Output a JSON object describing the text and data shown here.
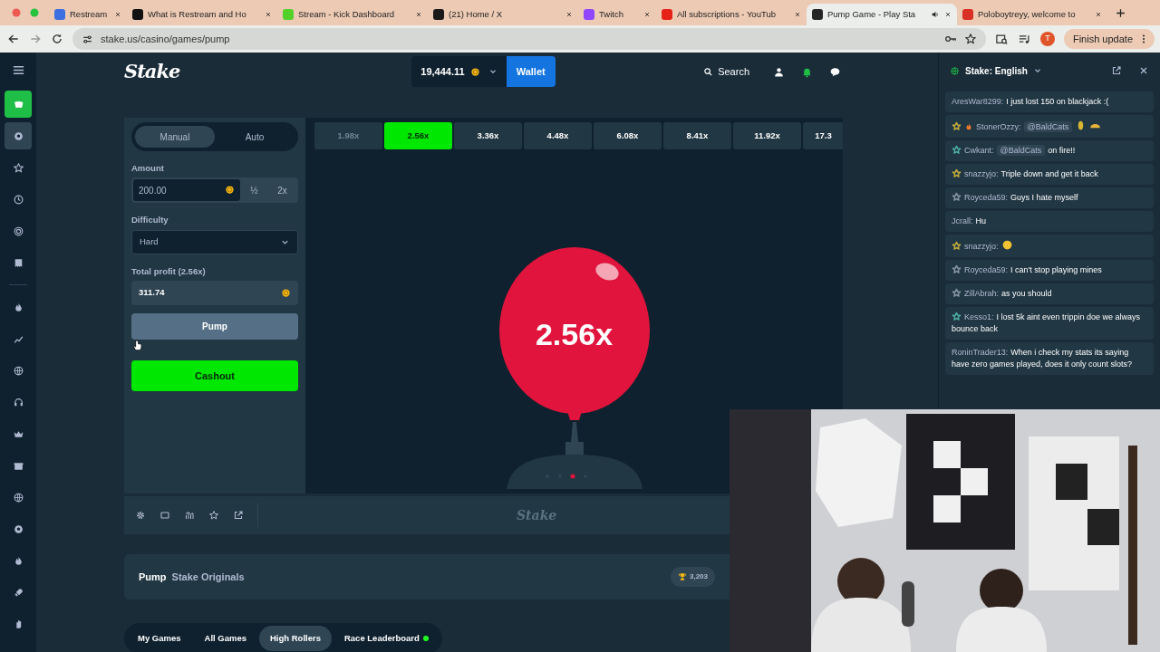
{
  "browser": {
    "tabs": [
      {
        "title": "Restream",
        "color": "#3d6fe0",
        "selected": false,
        "audio": false
      },
      {
        "title": "What is Restream and Ho",
        "color": "#111111",
        "selected": false,
        "audio": false
      },
      {
        "title": "Stream - Kick Dashboard",
        "color": "#53d12a",
        "selected": false,
        "audio": false
      },
      {
        "title": "(21) Home / X",
        "color": "#1a1a1a",
        "selected": false,
        "audio": false
      },
      {
        "title": "Twitch",
        "color": "#9147ff",
        "selected": false,
        "audio": false
      },
      {
        "title": "All subscriptions - YouTub",
        "color": "#e62117",
        "selected": false,
        "audio": false
      },
      {
        "title": "Pump Game - Play Sta",
        "color": "#262626",
        "selected": true,
        "audio": true
      },
      {
        "title": "Poloboytreyy, welcome to",
        "color": "#d93025",
        "selected": false,
        "audio": false
      }
    ],
    "url": "stake.us/casino/games/pump",
    "avatar": "T",
    "update_button": "Finish update"
  },
  "sidebar": {
    "items": [
      {
        "kind": "cards",
        "selected": true,
        "highlighted": false
      },
      {
        "kind": "ball",
        "selected": false,
        "highlighted": true
      },
      {
        "kind": "star",
        "selected": false,
        "highlighted": false
      },
      {
        "kind": "clock",
        "selected": false,
        "highlighted": false
      },
      {
        "kind": "target",
        "selected": false,
        "highlighted": false
      },
      {
        "kind": "receipt",
        "selected": false,
        "highlighted": false
      },
      {
        "kind": "divider"
      },
      {
        "kind": "fire",
        "selected": false,
        "highlighted": false
      },
      {
        "kind": "chart",
        "selected": false,
        "highlighted": false
      },
      {
        "kind": "globe",
        "selected": false,
        "highlighted": false
      },
      {
        "kind": "headset",
        "selected": false,
        "highlighted": false
      },
      {
        "kind": "crown",
        "selected": false,
        "highlighted": false
      },
      {
        "kind": "gift",
        "selected": false,
        "highlighted": false
      },
      {
        "kind": "globe",
        "selected": false,
        "highlighted": false
      },
      {
        "kind": "ball",
        "selected": false,
        "highlighted": false
      },
      {
        "kind": "fire",
        "selected": false,
        "highlighted": false
      },
      {
        "kind": "rocket",
        "selected": false,
        "highlighted": false
      },
      {
        "kind": "hand",
        "selected": false,
        "highlighted": false
      }
    ]
  },
  "header": {
    "logo": "Stake",
    "balance": "19,444.11",
    "wallet": "Wallet",
    "search": "Search"
  },
  "bet_panel": {
    "modes": [
      {
        "label": "Manual",
        "selected": true
      },
      {
        "label": "Auto",
        "selected": false
      }
    ],
    "amount_label": "Amount",
    "amount": "200.00",
    "half": "½",
    "double": "2x",
    "difficulty_label": "Difficulty",
    "difficulty": "Hard",
    "profit_label": "Total profit (2.56x)",
    "profit": "311.74",
    "pump": "Pump",
    "cashout": "Cashout"
  },
  "multipliers": [
    {
      "label": "1.98x",
      "passed": true,
      "selected": false
    },
    {
      "label": "2.56x",
      "passed": false,
      "selected": true
    },
    {
      "label": "3.36x",
      "passed": false,
      "selected": false
    },
    {
      "label": "4.48x",
      "passed": false,
      "selected": false
    },
    {
      "label": "6.08x",
      "passed": false,
      "selected": false
    },
    {
      "label": "8.41x",
      "passed": false,
      "selected": false
    },
    {
      "label": "11.92x",
      "passed": false,
      "selected": false
    },
    {
      "label": "17.3",
      "passed": false,
      "selected": false
    }
  ],
  "balloon": {
    "label": "2.56x"
  },
  "footer_logo": "Stake",
  "game_info": {
    "title": "Pump",
    "provider": "Stake Originals",
    "count": "3,203"
  },
  "lobby_tabs": [
    {
      "label": "My Games",
      "selected": false,
      "live": false
    },
    {
      "label": "All Games",
      "selected": false,
      "live": false
    },
    {
      "label": "High Rollers",
      "selected": true,
      "live": false
    },
    {
      "label": "Race Leaderboard",
      "selected": false,
      "live": true
    }
  ],
  "chat": {
    "room": "Stake: English",
    "messages": [
      {
        "user": "AresWar8299:",
        "fire": false,
        "parts": [
          {
            "kind": "text",
            "text": "I just lost 150 on blackjack :("
          }
        ]
      },
      {
        "user": "StonerOzzy:",
        "badge": {
          "color": "#c9b13c"
        },
        "fire": true,
        "parts": [
          {
            "kind": "mention",
            "text": "@BaldCats"
          },
          {
            "kind": "coin"
          },
          {
            "kind": "taco"
          }
        ]
      },
      {
        "user": "Cwkant:",
        "badge": {
          "color": "#4fb3a9"
        },
        "fire": false,
        "parts": [
          {
            "kind": "mention",
            "text": "@BaldCats"
          },
          {
            "kind": "text",
            "text": "on fire!!"
          }
        ]
      },
      {
        "user": "snazzyjo:",
        "badge": {
          "color": "#c9b13c"
        },
        "fire": false,
        "parts": [
          {
            "kind": "text",
            "text": "Triple down and get it back"
          }
        ]
      },
      {
        "user": "Royceda59:",
        "badge": {
          "color": "#8a9aa6"
        },
        "fire": false,
        "parts": [
          {
            "kind": "text",
            "text": "Guys I hate myself"
          }
        ]
      },
      {
        "user": "Jcrall:",
        "fire": false,
        "parts": [
          {
            "kind": "text",
            "text": "Hu"
          }
        ]
      },
      {
        "user": "snazzyjo:",
        "badge": {
          "color": "#c9b13c"
        },
        "fire": false,
        "parts": [
          {
            "kind": "smiley"
          }
        ]
      },
      {
        "user": "Royceda59:",
        "badge": {
          "color": "#8a9aa6"
        },
        "fire": false,
        "parts": [
          {
            "kind": "text",
            "text": "I can't stop playing mines"
          }
        ]
      },
      {
        "user": "ZillAbrah:",
        "badge": {
          "color": "#8a9aa6"
        },
        "fire": false,
        "parts": [
          {
            "kind": "text",
            "text": "as you should"
          }
        ]
      },
      {
        "user": "Kesso1:",
        "badge": {
          "color": "#4fb3a9"
        },
        "fire": false,
        "parts": [
          {
            "kind": "text",
            "text": "I lost 5k aint even trippin doe we always bounce back"
          }
        ]
      },
      {
        "user": "RoninTrader13:",
        "fire": false,
        "parts": [
          {
            "kind": "text",
            "text": "When i check my stats its saying have zero games played, does it only count slots?"
          }
        ]
      }
    ]
  }
}
